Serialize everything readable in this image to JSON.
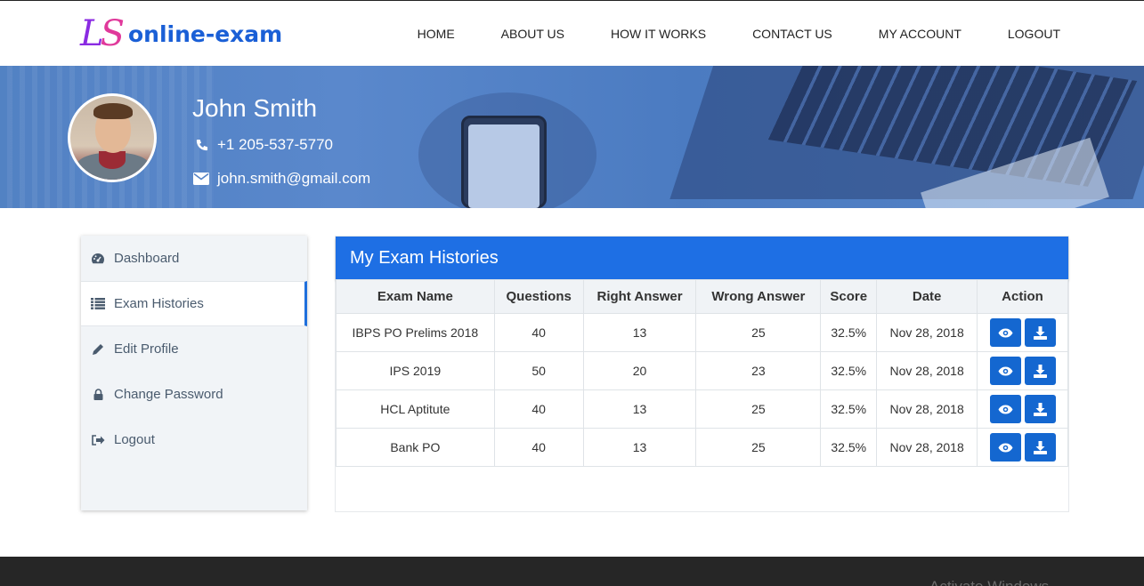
{
  "brand": {
    "mark": "LS",
    "name": "online-exam"
  },
  "nav": [
    "HOME",
    "ABOUT US",
    "HOW IT WORKS",
    "CONTACT US",
    "MY ACCOUNT",
    "LOGOUT"
  ],
  "profile": {
    "name": "John Smith",
    "phone": "+1 205-537-5770",
    "email": "john.smith@gmail.com"
  },
  "sidebar": {
    "items": [
      {
        "label": "Dashboard",
        "icon": "dashboard-icon"
      },
      {
        "label": "Exam Histories",
        "icon": "list-icon",
        "active": true
      },
      {
        "label": "Edit Profile",
        "icon": "pencil-icon"
      },
      {
        "label": "Change Password",
        "icon": "lock-icon"
      },
      {
        "label": "Logout",
        "icon": "sign-out-icon"
      }
    ]
  },
  "histories": {
    "title": "My Exam Histories",
    "columns": [
      "Exam Name",
      "Questions",
      "Right Answer",
      "Wrong Answer",
      "Score",
      "Date",
      "Action"
    ],
    "rows": [
      [
        "IBPS PO Prelims 2018",
        "40",
        "13",
        "25",
        "32.5%",
        "Nov 28, 2018"
      ],
      [
        "IPS 2019",
        "50",
        "20",
        "23",
        "32.5%",
        "Nov 28, 2018"
      ],
      [
        "HCL Aptitute",
        "40",
        "13",
        "25",
        "32.5%",
        "Nov 28, 2018"
      ],
      [
        "Bank PO",
        "40",
        "13",
        "25",
        "32.5%",
        "Nov 28, 2018"
      ]
    ]
  },
  "footer": {
    "watermark": "Activate Windows"
  },
  "colors": {
    "accent": "#1e6fe4",
    "button": "#1467d0",
    "footer": "#262626"
  }
}
